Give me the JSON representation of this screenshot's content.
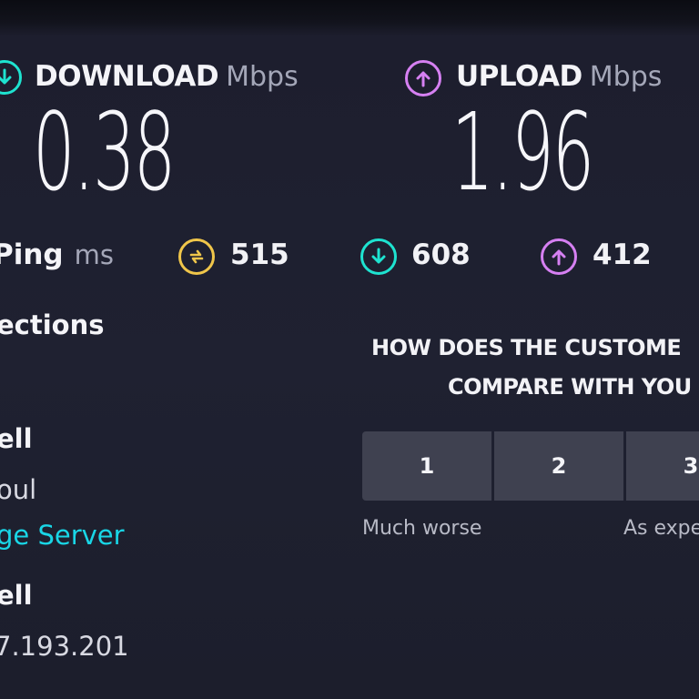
{
  "download": {
    "label": "DOWNLOAD",
    "unit": "Mbps",
    "value": "0.38",
    "icon": "arrow-down-circle-icon",
    "color": "#1ee3d0"
  },
  "upload": {
    "label": "UPLOAD",
    "unit": "Mbps",
    "value": "1.96",
    "icon": "arrow-up-circle-icon",
    "color": "#d680f2"
  },
  "ping": {
    "label": "Ping",
    "unit": "ms",
    "idle": {
      "value": "515",
      "icon": "idle-ping-icon",
      "color": "#f0c64a"
    },
    "download": {
      "value": "608",
      "icon": "download-ping-icon",
      "color": "#1ee3d0"
    },
    "upload": {
      "value": "412",
      "icon": "upload-ping-icon",
      "color": "#d680f2"
    }
  },
  "connections": {
    "title": "ections",
    "isp_name": "ell",
    "location": "oul",
    "change_server_link": "ge Server",
    "host_name": "ell",
    "ip": "7.193.201",
    "link_color": "#19d6e6"
  },
  "survey": {
    "question_line1": "HOW DOES THE CUSTOME",
    "question_line2": "COMPARE WITH YOU",
    "options": [
      "1",
      "2",
      "3"
    ],
    "scale_low": "Much worse",
    "scale_mid": "As expe"
  }
}
